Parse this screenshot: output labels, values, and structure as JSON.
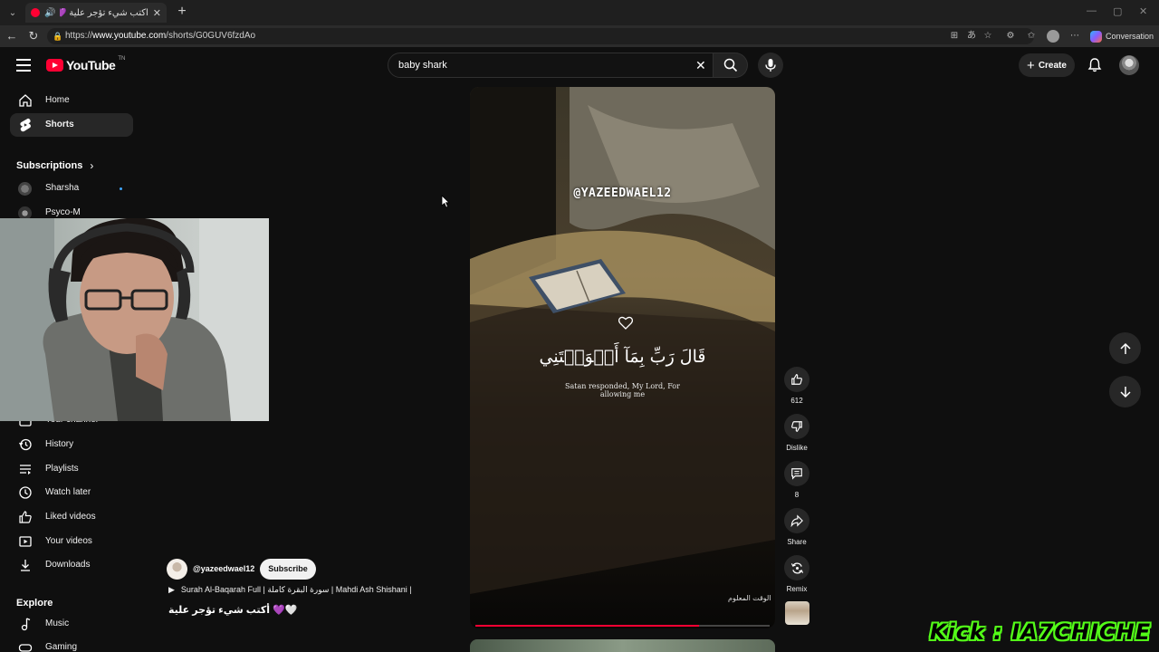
{
  "browser": {
    "tab_title": "أكتب شيء تؤجر علية 💜 - ‎be",
    "url_prefix": "https://",
    "url_host": "www.youtube.com",
    "url_path": "/shorts/G0GUV6fzdAo",
    "copilot_label": "Conversation"
  },
  "masthead": {
    "logo_text": "YouTube",
    "logo_suffix": "TN",
    "search_value": "baby shark",
    "create_label": "Create"
  },
  "sidebar": {
    "home": "Home",
    "shorts": "Shorts",
    "subscriptions_heading": "Subscriptions",
    "subs": [
      "Sharsha",
      "Psyco-M"
    ],
    "your_channel": "Your channel",
    "history": "History",
    "playlists": "Playlists",
    "watch_later": "Watch later",
    "liked_videos": "Liked videos",
    "your_videos": "Your videos",
    "downloads": "Downloads",
    "explore_heading": "Explore",
    "music": "Music",
    "gaming": "Gaming"
  },
  "short": {
    "handle_overlay": "@YAZEEDWAEL12",
    "arabic_verse": "قَالَ رَبِّ بِمَآ أَغۡوَيۡتَنِي",
    "translation": "Satan responded, My Lord, For allowing me",
    "watermark": "الوقت المعلوم",
    "progress": 0.76
  },
  "actions": {
    "likes": "612",
    "dislike_label": "Dislike",
    "comments": "8",
    "share_label": "Share",
    "remix_label": "Remix"
  },
  "channel": {
    "name": "@yazeedwael12",
    "subscribe_label": "Subscribe",
    "playlist_title": "Surah Al-Baqarah Full | سورة البقرة كاملة | Mahdi Ash Shishani |",
    "short_title": "أكتب شيء تؤجر علية 💜🤍"
  },
  "overlay": {
    "kick_text": "Kick : IA7CHICHE"
  },
  "colors": {
    "accent": "#ff0033",
    "background": "#0f0f0f",
    "kick_green": "#53fc18"
  }
}
